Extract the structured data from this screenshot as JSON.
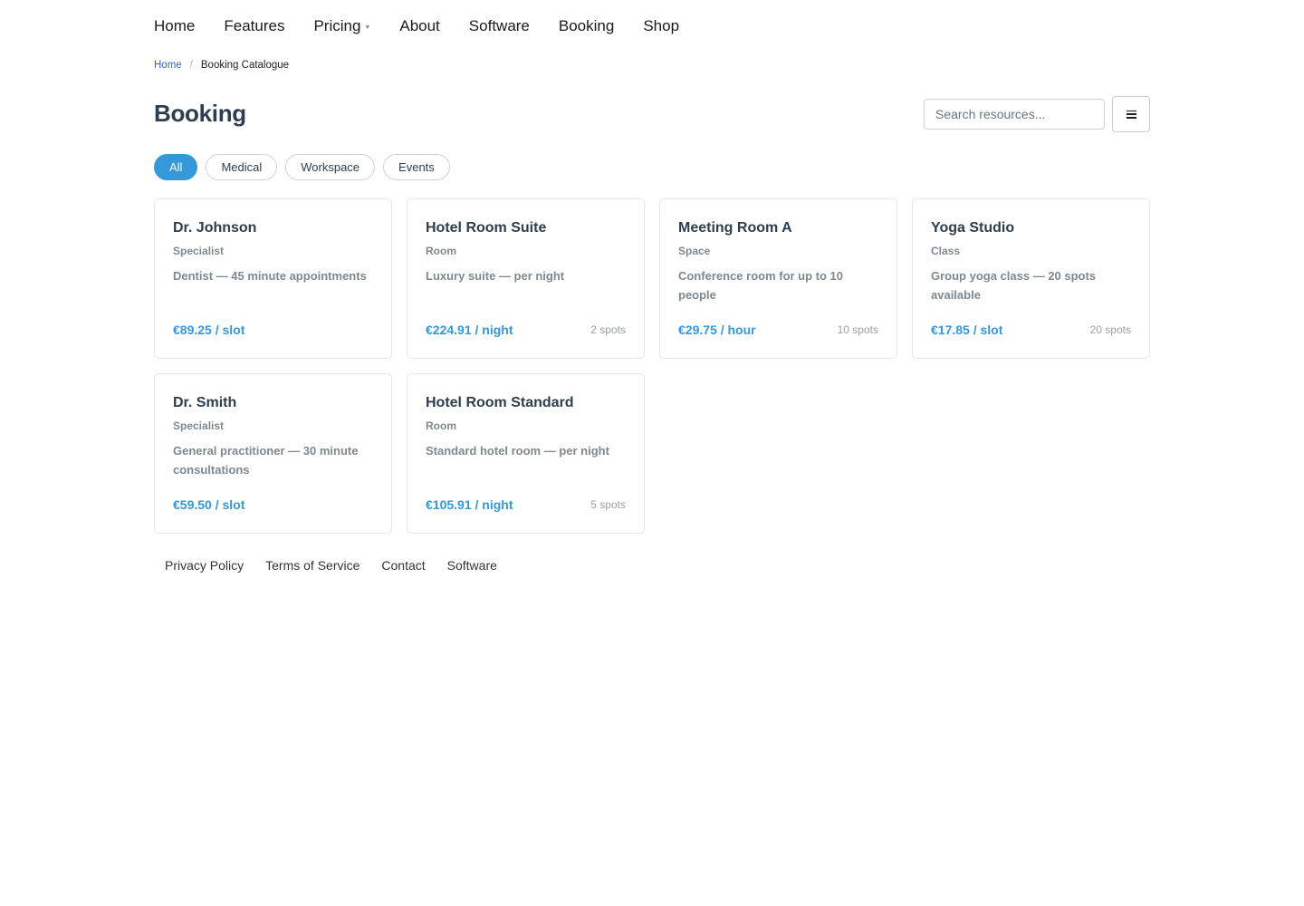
{
  "nav": {
    "items": [
      {
        "label": "Home"
      },
      {
        "label": "Features"
      },
      {
        "label": "Pricing",
        "has_dropdown": true
      },
      {
        "label": "About"
      },
      {
        "label": "Software"
      },
      {
        "label": "Booking"
      },
      {
        "label": "Shop"
      }
    ]
  },
  "breadcrumb": {
    "home": "Home",
    "separator": "/",
    "current": "Booking Catalogue"
  },
  "page": {
    "title": "Booking"
  },
  "search": {
    "placeholder": "Search resources...",
    "value": ""
  },
  "filters": {
    "items": [
      {
        "label": "All",
        "active": true
      },
      {
        "label": "Medical",
        "active": false
      },
      {
        "label": "Workspace",
        "active": false
      },
      {
        "label": "Events",
        "active": false
      }
    ]
  },
  "cards": [
    {
      "name": "Dr. Johnson",
      "type": "Specialist",
      "description": "Dentist — 45 minute appointments",
      "price": "€89.25 / slot",
      "spots": ""
    },
    {
      "name": "Hotel Room Suite",
      "type": "Room",
      "description": "Luxury suite — per night",
      "price": "€224.91 / night",
      "spots": "2 spots"
    },
    {
      "name": "Meeting Room A",
      "type": "Space",
      "description": "Conference room for up to 10 people",
      "price": "€29.75 / hour",
      "spots": "10 spots"
    },
    {
      "name": "Yoga Studio",
      "type": "Class",
      "description": "Group yoga class — 20 spots available",
      "price": "€17.85 / slot",
      "spots": "20 spots"
    },
    {
      "name": "Dr. Smith",
      "type": "Specialist",
      "description": "General practitioner — 30 minute consultations",
      "price": "€59.50 / slot",
      "spots": ""
    },
    {
      "name": "Hotel Room Standard",
      "type": "Room",
      "description": "Standard hotel room — per night",
      "price": "€105.91 / night",
      "spots": "5 spots"
    }
  ],
  "footer": {
    "links": [
      {
        "label": "Privacy Policy"
      },
      {
        "label": "Terms of Service"
      },
      {
        "label": "Contact"
      },
      {
        "label": "Software"
      }
    ]
  },
  "icons": {
    "menu_button": "hamburger-icon",
    "pricing_dropdown": "caret-down-icon"
  },
  "colors": {
    "accent": "#3498db",
    "link": "#2f64d6",
    "title": "#2c3e50",
    "muted": "#7f8890"
  }
}
